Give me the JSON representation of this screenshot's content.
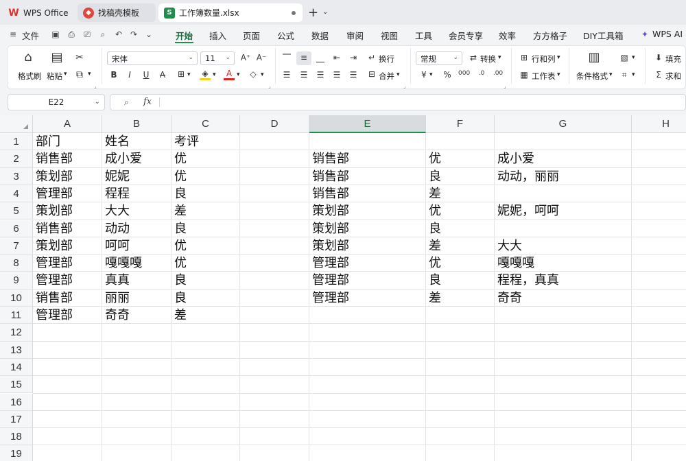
{
  "tabs": {
    "wps_label": "WPS Office",
    "template_label": "找稿壳模板",
    "doc_label": "工作簿数量.xlsx",
    "doc_icon_letter": "S"
  },
  "menu": {
    "file_label": "文件",
    "items": [
      "开始",
      "插入",
      "页面",
      "公式",
      "数据",
      "审阅",
      "视图",
      "工具",
      "会员专享",
      "效率",
      "方方格子",
      "DIY工具箱"
    ],
    "ai_label": "WPS AI"
  },
  "ribbon": {
    "format_painter": "格式刷",
    "paste": "粘贴",
    "font_name": "宋体",
    "font_size": "11",
    "wrap": "换行",
    "merge": "合并",
    "number_format": "常规",
    "convert": "转换",
    "row_col": "行和列",
    "sheet": "工作表",
    "cond_format": "条件格式",
    "fill": "填充",
    "sum": "求和"
  },
  "formula_bar": {
    "cell_ref": "E22",
    "fx_label": "fx"
  },
  "grid": {
    "columns": [
      "A",
      "B",
      "C",
      "D",
      "E",
      "F",
      "G",
      "H"
    ],
    "rows": [
      "1",
      "2",
      "3",
      "4",
      "5",
      "6",
      "7",
      "8",
      "9",
      "10",
      "11",
      "12",
      "13",
      "14",
      "15",
      "16",
      "17",
      "18",
      "19"
    ],
    "selected_column": "E",
    "cells": {
      "A": [
        "部门",
        "销售部",
        "策划部",
        "管理部",
        "策划部",
        "销售部",
        "策划部",
        "管理部",
        "管理部",
        "销售部",
        "管理部"
      ],
      "B": [
        "姓名",
        "成小爱",
        "妮妮",
        "程程",
        "大大",
        "动动",
        "呵呵",
        "嘎嘎嘎",
        "真真",
        "丽丽",
        "奇奇"
      ],
      "C": [
        "考评",
        "优",
        "优",
        "良",
        "差",
        "良",
        "优",
        "优",
        "良",
        "良",
        "差"
      ],
      "E": [
        "",
        "销售部",
        "销售部",
        "销售部",
        "策划部",
        "策划部",
        "策划部",
        "管理部",
        "管理部",
        "管理部",
        ""
      ],
      "F": [
        "",
        "优",
        "良",
        "差",
        "优",
        "良",
        "差",
        "优",
        "良",
        "差",
        ""
      ],
      "G": [
        "",
        "成小爱",
        "动动，丽丽",
        "",
        "妮妮，呵呵",
        "",
        "大大",
        "嘎嘎嘎",
        "程程，真真",
        "奇奇",
        ""
      ]
    }
  },
  "colors": {
    "accent": "#1f8f4e",
    "header_bg": "#f5f6f7",
    "gridline": "#e1e3e5"
  }
}
